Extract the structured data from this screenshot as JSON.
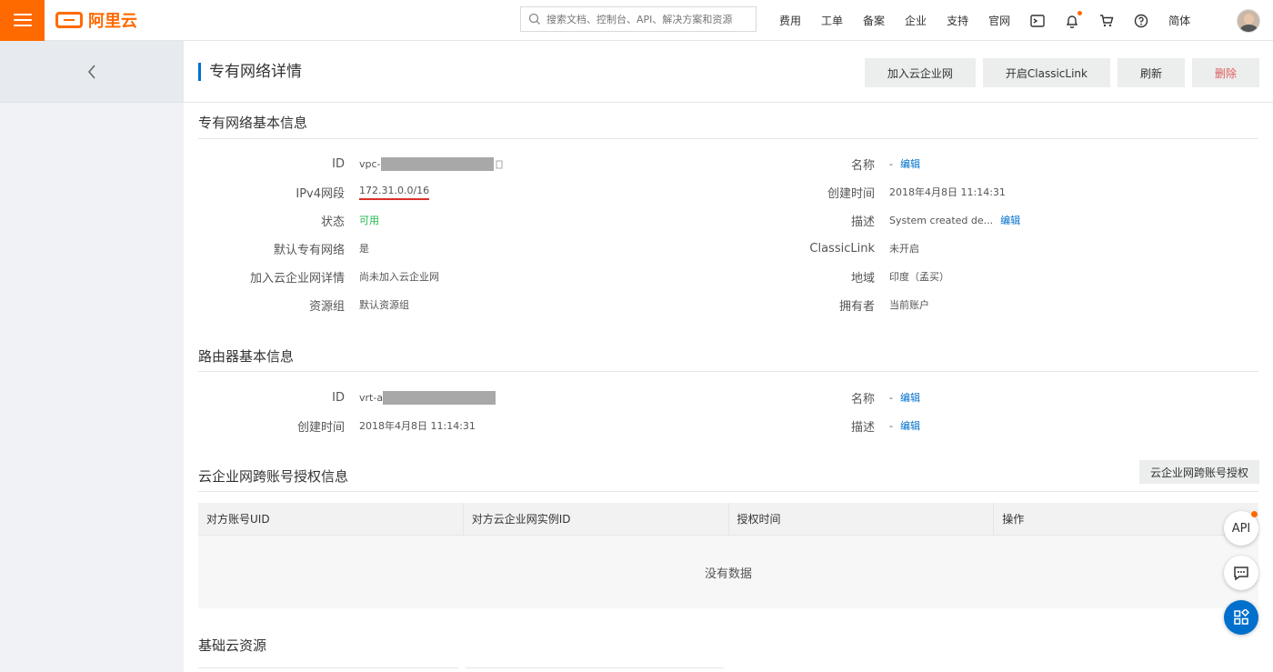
{
  "topbar": {
    "brand": "阿里云",
    "search_placeholder": "搜索文档、控制台、API、解决方案和资源",
    "nav": [
      "费用",
      "工单",
      "备案",
      "企业",
      "支持",
      "官网"
    ],
    "lang": "简体"
  },
  "page": {
    "title": "专有网络详情",
    "actions": {
      "join_cen": "加入云企业网",
      "classiclink": "开启ClassicLink",
      "refresh": "刷新",
      "delete": "删除"
    }
  },
  "vpc_info": {
    "section_title": "专有网络基本信息",
    "left": [
      {
        "label": "ID",
        "value": "vpc-"
      },
      {
        "label": "IPv4网段",
        "value": "172.31.0.0/16"
      },
      {
        "label": "状态",
        "value": "可用"
      },
      {
        "label": "默认专有网络",
        "value": "是"
      },
      {
        "label": "加入云企业网详情",
        "value": "尚未加入云企业网"
      },
      {
        "label": "资源组",
        "value": "默认资源组"
      }
    ],
    "right": [
      {
        "label": "名称",
        "value": "-",
        "action": "编辑"
      },
      {
        "label": "创建时间",
        "value": "2018年4月8日 11:14:31"
      },
      {
        "label": "描述",
        "value": "System created de...",
        "action": "编辑"
      },
      {
        "label": "ClassicLink",
        "value": "未开启"
      },
      {
        "label": "地域",
        "value": "印度（孟买）"
      },
      {
        "label": "拥有者",
        "value": "当前账户"
      }
    ]
  },
  "router_info": {
    "section_title": "路由器基本信息",
    "left": [
      {
        "label": "ID",
        "value": "vrt-a"
      },
      {
        "label": "创建时间",
        "value": "2018年4月8日 11:14:31"
      }
    ],
    "right": [
      {
        "label": "名称",
        "value": "-",
        "action": "编辑"
      },
      {
        "label": "描述",
        "value": "-",
        "action": "编辑"
      }
    ]
  },
  "cen_auth": {
    "section_title": "云企业网跨账号授权信息",
    "button": "云企业网跨账号授权",
    "columns": [
      "对方账号UID",
      "对方云企业网实例ID",
      "授权时间",
      "操作"
    ],
    "empty_text": "没有数据"
  },
  "basic_resources": {
    "section_title": "基础云资源"
  },
  "float": {
    "api_label": "API"
  },
  "colors": {
    "brand": "#ff6a00",
    "link": "#0070cc",
    "success": "#1fb84d",
    "danger": "#e05c5c"
  }
}
